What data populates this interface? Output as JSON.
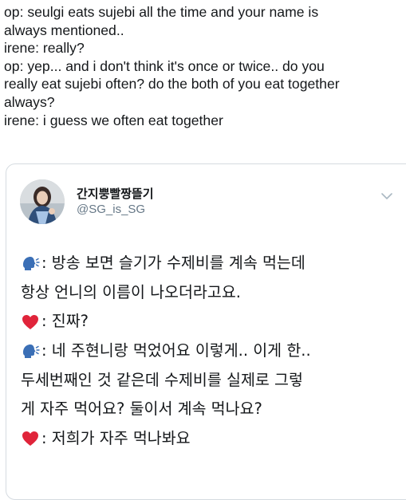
{
  "outer_post": {
    "lines": [
      "op: seulgi eats sujebi all the time and your name is",
      "always mentioned..",
      "irene: really?",
      "op: yep... and i don't think it's once or twice.. do you",
      "really eat sujebi often? do the both of you eat together",
      "always?",
      "irene: i guess we often eat together"
    ]
  },
  "quoted_tweet": {
    "display_name": "간지뿡빨짱뜰기",
    "handle": "@SG_is_SG",
    "lines": [
      {
        "emoji": "speaking-head-icon",
        "text": ": 방송 보면 슬기가 수제비를 계속 먹는데"
      },
      {
        "emoji": "",
        "text": "항상 언니의 이름이 나오더라고요."
      },
      {
        "emoji": "red-heart-icon",
        "text": ": 진짜?"
      },
      {
        "emoji": "speaking-head-icon",
        "text": ": 네 주현니랑 먹었어요 이렇게.. 이게 한.."
      },
      {
        "emoji": "",
        "text": "두세번째인 것 같은데 수제비를 실제로 그렇"
      },
      {
        "emoji": "",
        "text": "게 자주 먹어요? 둘이서 계속 먹나요?"
      },
      {
        "emoji": "red-heart-icon",
        "text": ": 저희가 자주 먹나봐요"
      }
    ]
  },
  "colors": {
    "text": "#14171a",
    "secondary": "#657786",
    "border": "#d5dbe0",
    "heart": "#e0243a",
    "speaking_head": "#3b6fb6"
  }
}
